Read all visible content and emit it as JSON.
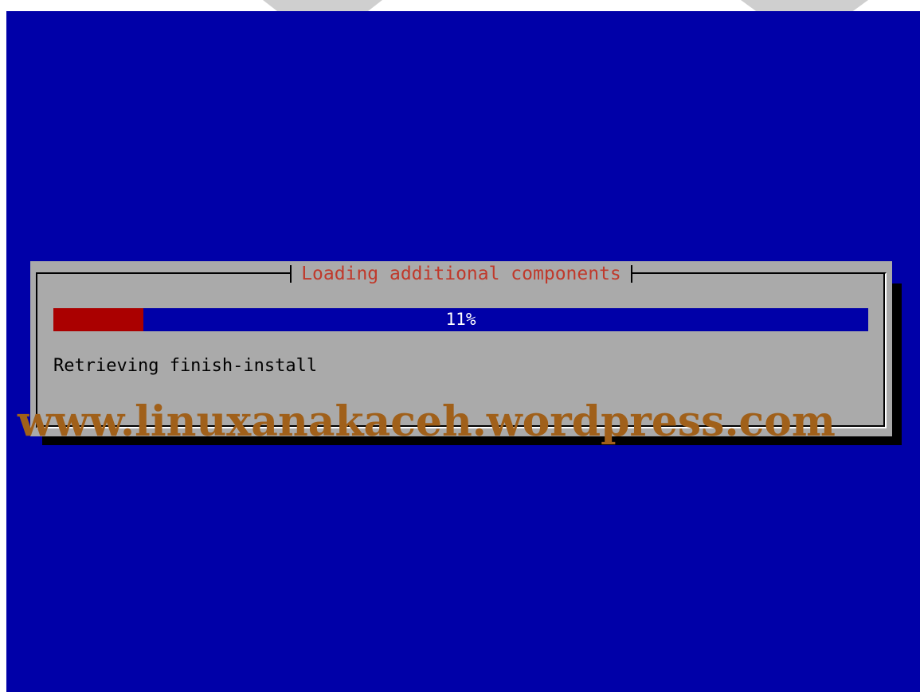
{
  "window": {
    "background_color": "#0000a8"
  },
  "dialog": {
    "title": "Loading additional components",
    "title_color": "#c0392b",
    "background_color": "#aaaaaa",
    "progress": {
      "percent": 11,
      "label": "11%",
      "fill_color": "#aa0000",
      "track_color": "#0000a8"
    },
    "status": "Retrieving finish-install"
  },
  "watermark": {
    "text": "www.linuxanakaceh.wordpress.com",
    "color": "#a0601a"
  }
}
